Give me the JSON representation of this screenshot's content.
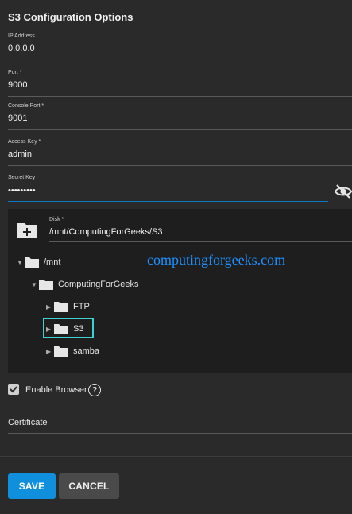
{
  "title": "S3 Configuration Options",
  "fields": {
    "ip": {
      "label": "IP Address",
      "value": "0.0.0.0"
    },
    "port": {
      "label": "Port *",
      "value": "9000"
    },
    "console_port": {
      "label": "Console Port *",
      "value": "9001"
    },
    "access_key": {
      "label": "Access Key *",
      "value": "admin"
    },
    "secret_key": {
      "label": "Secret Key",
      "value": "•••••••••"
    }
  },
  "disk": {
    "label": "Disk *",
    "value": "/mnt/ComputingForGeeks/S3"
  },
  "tree": {
    "root": "/mnt",
    "child": "ComputingForGeeks",
    "leaves": [
      "FTP",
      "S3",
      "samba"
    ]
  },
  "watermark": "computingforgeeks.com",
  "enable_browser": {
    "label": "Enable Browser",
    "checked": true,
    "help": "?"
  },
  "certificate": {
    "label": "Certificate"
  },
  "buttons": {
    "save": "SAVE",
    "cancel": "CANCEL"
  },
  "colors": {
    "accent": "#0f8fdc",
    "selection": "#3dd1d1",
    "background": "#2a2a2a"
  },
  "icons": {
    "visibility": "eye-off-icon",
    "add_folder": "folder-plus-icon",
    "folder": "folder-icon",
    "help": "help-circle-icon"
  }
}
